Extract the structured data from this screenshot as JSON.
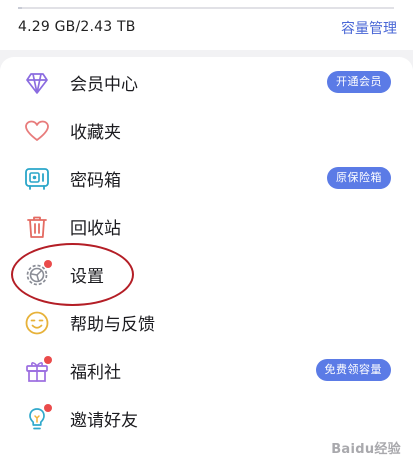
{
  "storage": {
    "usage_text": "4.29 GB/2.43 TB",
    "manage_label": "容量管理",
    "used_fraction": 0.0017
  },
  "menu": {
    "items": [
      {
        "label": "会员中心",
        "icon": "diamond-icon",
        "badge": "开通会员"
      },
      {
        "label": "收藏夹",
        "icon": "heart-icon"
      },
      {
        "label": "密码箱",
        "icon": "safe-icon",
        "badge": "原保险箱"
      },
      {
        "label": "回收站",
        "icon": "trash-icon"
      },
      {
        "label": "设置",
        "icon": "gear-icon",
        "dot": true
      },
      {
        "label": "帮助与反馈",
        "icon": "smiley-icon"
      },
      {
        "label": "福利社",
        "icon": "gift-icon",
        "dot": true,
        "badge": "免费领容量"
      },
      {
        "label": "邀请好友",
        "icon": "lightbulb-icon",
        "dot": true
      }
    ]
  },
  "colors": {
    "accent": "#5b7be6",
    "link": "#4a67d6",
    "dot": "#ea4b4b",
    "annotation": "#b41e26"
  },
  "watermark": "Baidu经验"
}
